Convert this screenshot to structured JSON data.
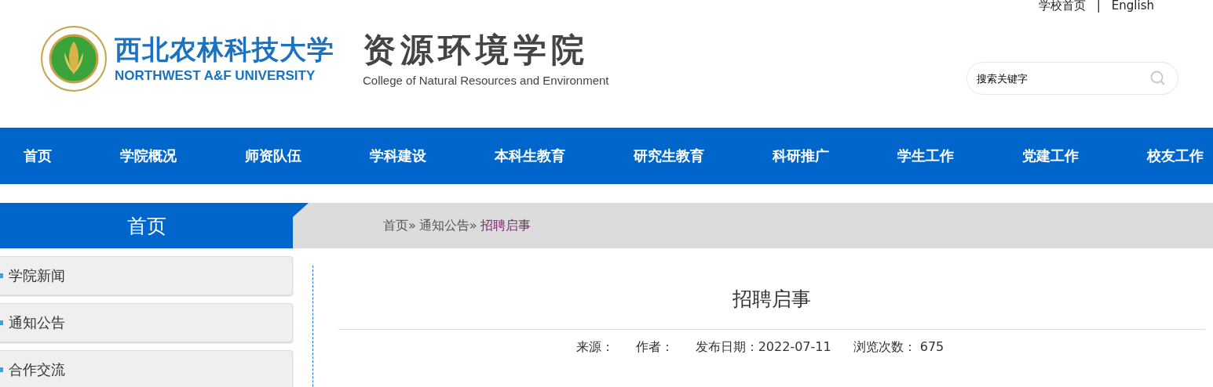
{
  "top_links": [
    {
      "label": "学校首页"
    },
    {
      "label": "|"
    },
    {
      "label": "English"
    }
  ],
  "logo": {
    "university_cn": "西北农林科技大学",
    "university_en": "NORTHWEST A&F UNIVERSITY",
    "college_cn": "资源环境学院",
    "college_en": "College of Natural Resources and Environment"
  },
  "search": {
    "placeholder": "搜索关键字"
  },
  "nav": [
    "首页",
    "学院概况",
    "师资队伍",
    "学科建设",
    "本科生教育",
    "研究生教育",
    "科研推广",
    "学生工作",
    "党建工作",
    "校友工作"
  ],
  "section_title": "首页",
  "breadcrumb": [
    {
      "label": "首页»",
      "current": false
    },
    {
      "label": "通知公告»",
      "current": false
    },
    {
      "label": "招聘启事",
      "current": true
    }
  ],
  "sidebar": {
    "items": [
      "学院新闻",
      "通知公告",
      "合作交流"
    ]
  },
  "article": {
    "title": "招聘启事",
    "meta": [
      "来源：",
      "作者：",
      "发布日期：2022-07-11",
      "浏览次数： 675"
    ]
  }
}
